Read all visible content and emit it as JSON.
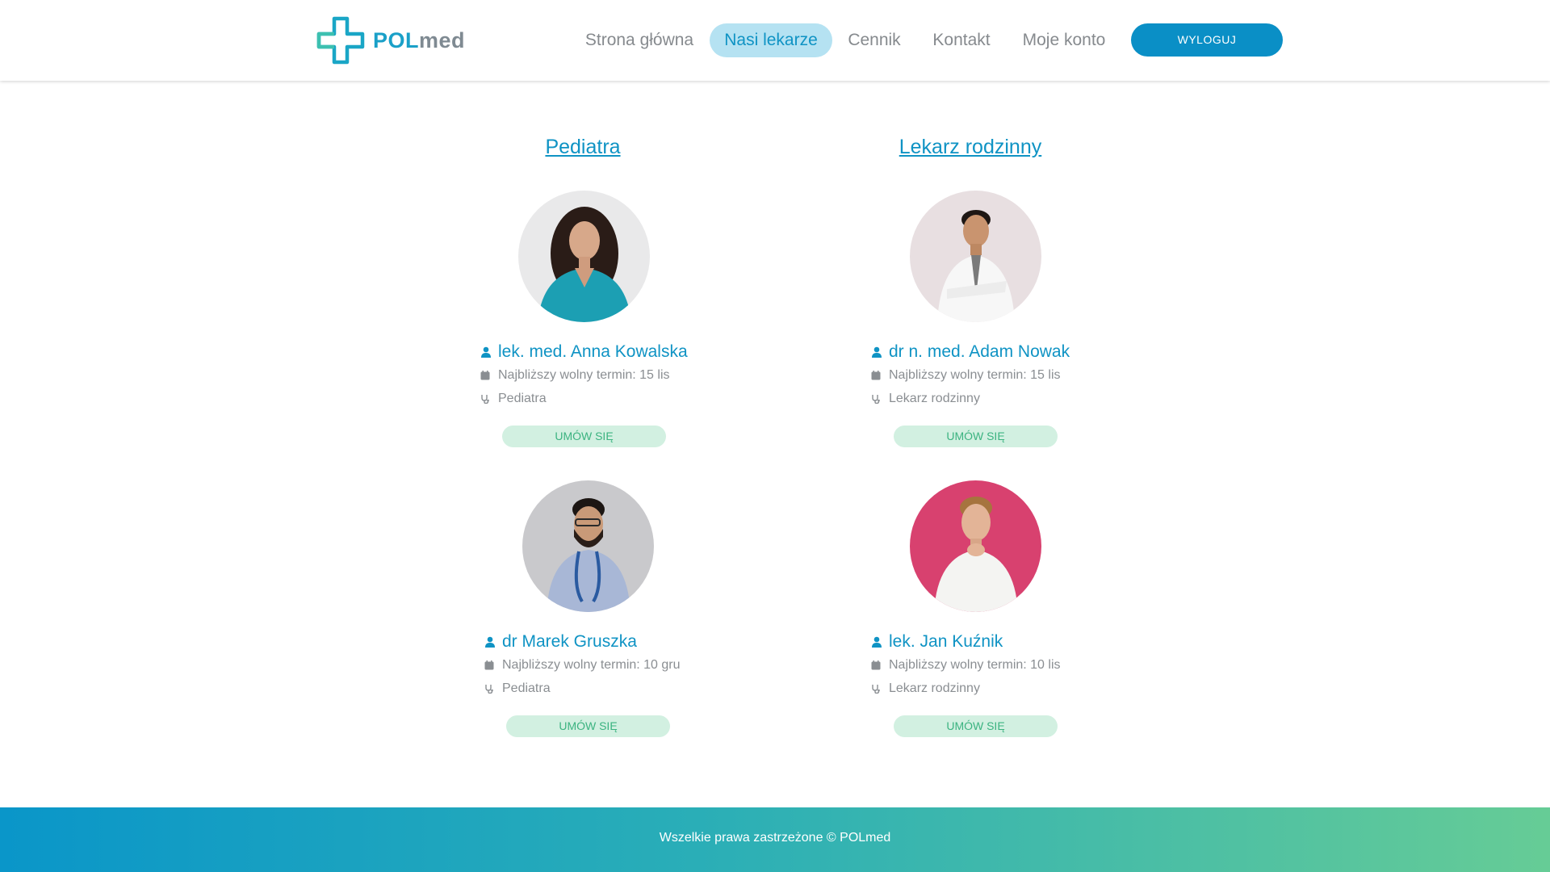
{
  "brand": {
    "name_part1": "POL",
    "name_part2": "med",
    "colors": {
      "primary": "#0f93c4",
      "accent": "#3bb380",
      "nav_active_bg": "#b5e2f2"
    }
  },
  "nav": {
    "items": [
      {
        "label": "Strona główna",
        "active": false
      },
      {
        "label": "Nasi lekarze",
        "active": true
      },
      {
        "label": "Cennik",
        "active": false
      },
      {
        "label": "Kontakt",
        "active": false
      },
      {
        "label": "Moje konto",
        "active": false
      }
    ],
    "logout_label": "WYLOGUJ"
  },
  "sections": [
    {
      "title": "Pediatra",
      "doctors": [
        {
          "name": "lek. med. Anna Kowalska",
          "next_slot": "Najbliższy wolny termin: 15 lis",
          "specialty": "Pediatra",
          "button": "UMÓW SIĘ"
        },
        {
          "name": "dr Marek Gruszka",
          "next_slot": "Najbliższy wolny termin: 10 gru",
          "specialty": "Pediatra",
          "button": "UMÓW SIĘ"
        }
      ]
    },
    {
      "title": "Lekarz rodzinny",
      "doctors": [
        {
          "name": "dr n. med. Adam Nowak",
          "next_slot": "Najbliższy wolny termin: 15 lis",
          "specialty": "Lekarz rodzinny",
          "button": "UMÓW SIĘ"
        },
        {
          "name": "lek. Jan Kuźnik",
          "next_slot": "Najbliższy wolny termin: 10 lis",
          "specialty": "Lekarz rodzinny",
          "button": "UMÓW SIĘ"
        }
      ]
    }
  ],
  "footer": {
    "text": "Wszelkie prawa zastrzeżone © POLmed"
  }
}
